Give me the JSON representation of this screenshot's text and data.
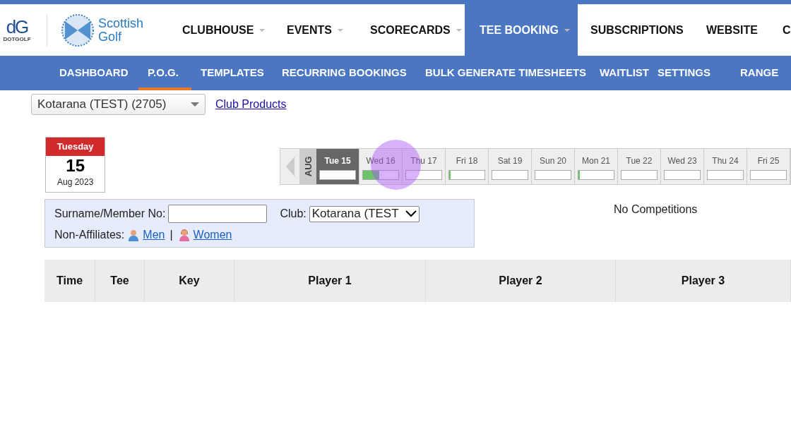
{
  "brand": {
    "mark": "dG",
    "name": "DOTGOLF",
    "partner": "Scottish Golf"
  },
  "main_nav": [
    {
      "label": "CLUBHOUSE",
      "dropdown": true,
      "selected": false
    },
    {
      "label": "EVENTS",
      "dropdown": true,
      "selected": false
    },
    {
      "label": "SCORECARDS",
      "dropdown": true,
      "selected": false
    },
    {
      "label": "TEE BOOKING",
      "dropdown": true,
      "selected": true
    },
    {
      "label": "SUBSCRIPTIONS",
      "dropdown": false,
      "selected": false
    },
    {
      "label": "WEBSITE",
      "dropdown": false,
      "selected": false
    },
    {
      "label": "C",
      "selected": false
    }
  ],
  "sub_nav": [
    {
      "label": "DASHBOARD",
      "selected": false
    },
    {
      "label": "P.O.G.",
      "selected": true
    },
    {
      "label": "TEMPLATES",
      "selected": false
    },
    {
      "label": "RECURRING BOOKINGS",
      "selected": false
    },
    {
      "label": "BULK GENERATE TIMESHEETS",
      "selected": false
    },
    {
      "label": "WAITLIST",
      "selected": false
    },
    {
      "label": "SETTINGS",
      "selected": false
    },
    {
      "label": "RANGE",
      "selected": false
    }
  ],
  "club_select": {
    "value": "Kotarana (TEST) (2705)"
  },
  "club_products_link": "Club Products",
  "date_card": {
    "weekday": "Tuesday",
    "day": "15",
    "month_year": "Aug 2023"
  },
  "day_strip": {
    "month": "AUG",
    "days": [
      {
        "label": "Tue 15",
        "selected": true,
        "level": 0
      },
      {
        "label": "Wed 16",
        "selected": false,
        "level": 0.45
      },
      {
        "label": "Thu 17",
        "selected": false,
        "level": 0
      },
      {
        "label": "Fri 18",
        "selected": false,
        "level": 0.03
      },
      {
        "label": "Sat 19",
        "selected": false,
        "level": 0
      },
      {
        "label": "Sun 20",
        "selected": false,
        "level": 0
      },
      {
        "label": "Mon 21",
        "selected": false,
        "level": 0.03
      },
      {
        "label": "Tue 22",
        "selected": false,
        "level": 0
      },
      {
        "label": "Wed 23",
        "selected": false,
        "level": 0
      },
      {
        "label": "Thu 24",
        "selected": false,
        "level": 0
      },
      {
        "label": "Fri 25",
        "selected": false,
        "level": 0
      }
    ]
  },
  "click_highlight": true,
  "search": {
    "surname_label": "Surname/Member No:",
    "club_label": "Club:",
    "club_value": "Kotarana (TEST",
    "non_affiliates_label": "Non-Affiliates:",
    "men_link": "Men",
    "separator": "|",
    "women_link": "Women"
  },
  "competitions": "No Competitions",
  "table": {
    "columns": [
      "Time",
      "Tee",
      "Key",
      "Player 1",
      "Player 2",
      "Player 3"
    ]
  }
}
